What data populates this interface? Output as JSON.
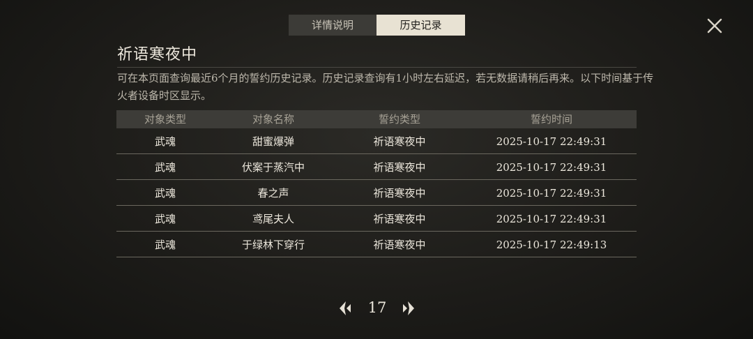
{
  "tabs": [
    {
      "label": "详情说明",
      "active": false
    },
    {
      "label": "历史记录",
      "active": true
    }
  ],
  "title": "祈语寒夜中",
  "description": "可在本页面查询最近6个月的誓约历史记录。历史记录查询有1小时左右延迟，若无数据请稍后再来。以下时间基于传火者设备时区显示。",
  "table": {
    "headers": [
      "对象类型",
      "对象名称",
      "誓约类型",
      "誓约时间"
    ],
    "rows": [
      [
        "武魂",
        "甜蜜爆弹",
        "祈语寒夜中",
        "2025-10-17 22:49:31"
      ],
      [
        "武魂",
        "伏案于蒸汽中",
        "祈语寒夜中",
        "2025-10-17 22:49:31"
      ],
      [
        "武魂",
        "春之声",
        "祈语寒夜中",
        "2025-10-17 22:49:31"
      ],
      [
        "武魂",
        "鸢尾夫人",
        "祈语寒夜中",
        "2025-10-17 22:49:31"
      ],
      [
        "武魂",
        "于绿林下穿行",
        "祈语寒夜中",
        "2025-10-17 22:49:13"
      ]
    ]
  },
  "pager": {
    "page": "17"
  },
  "icons": {
    "close": "close-icon",
    "prev": "arrow-left-icon",
    "next": "arrow-right-icon"
  }
}
